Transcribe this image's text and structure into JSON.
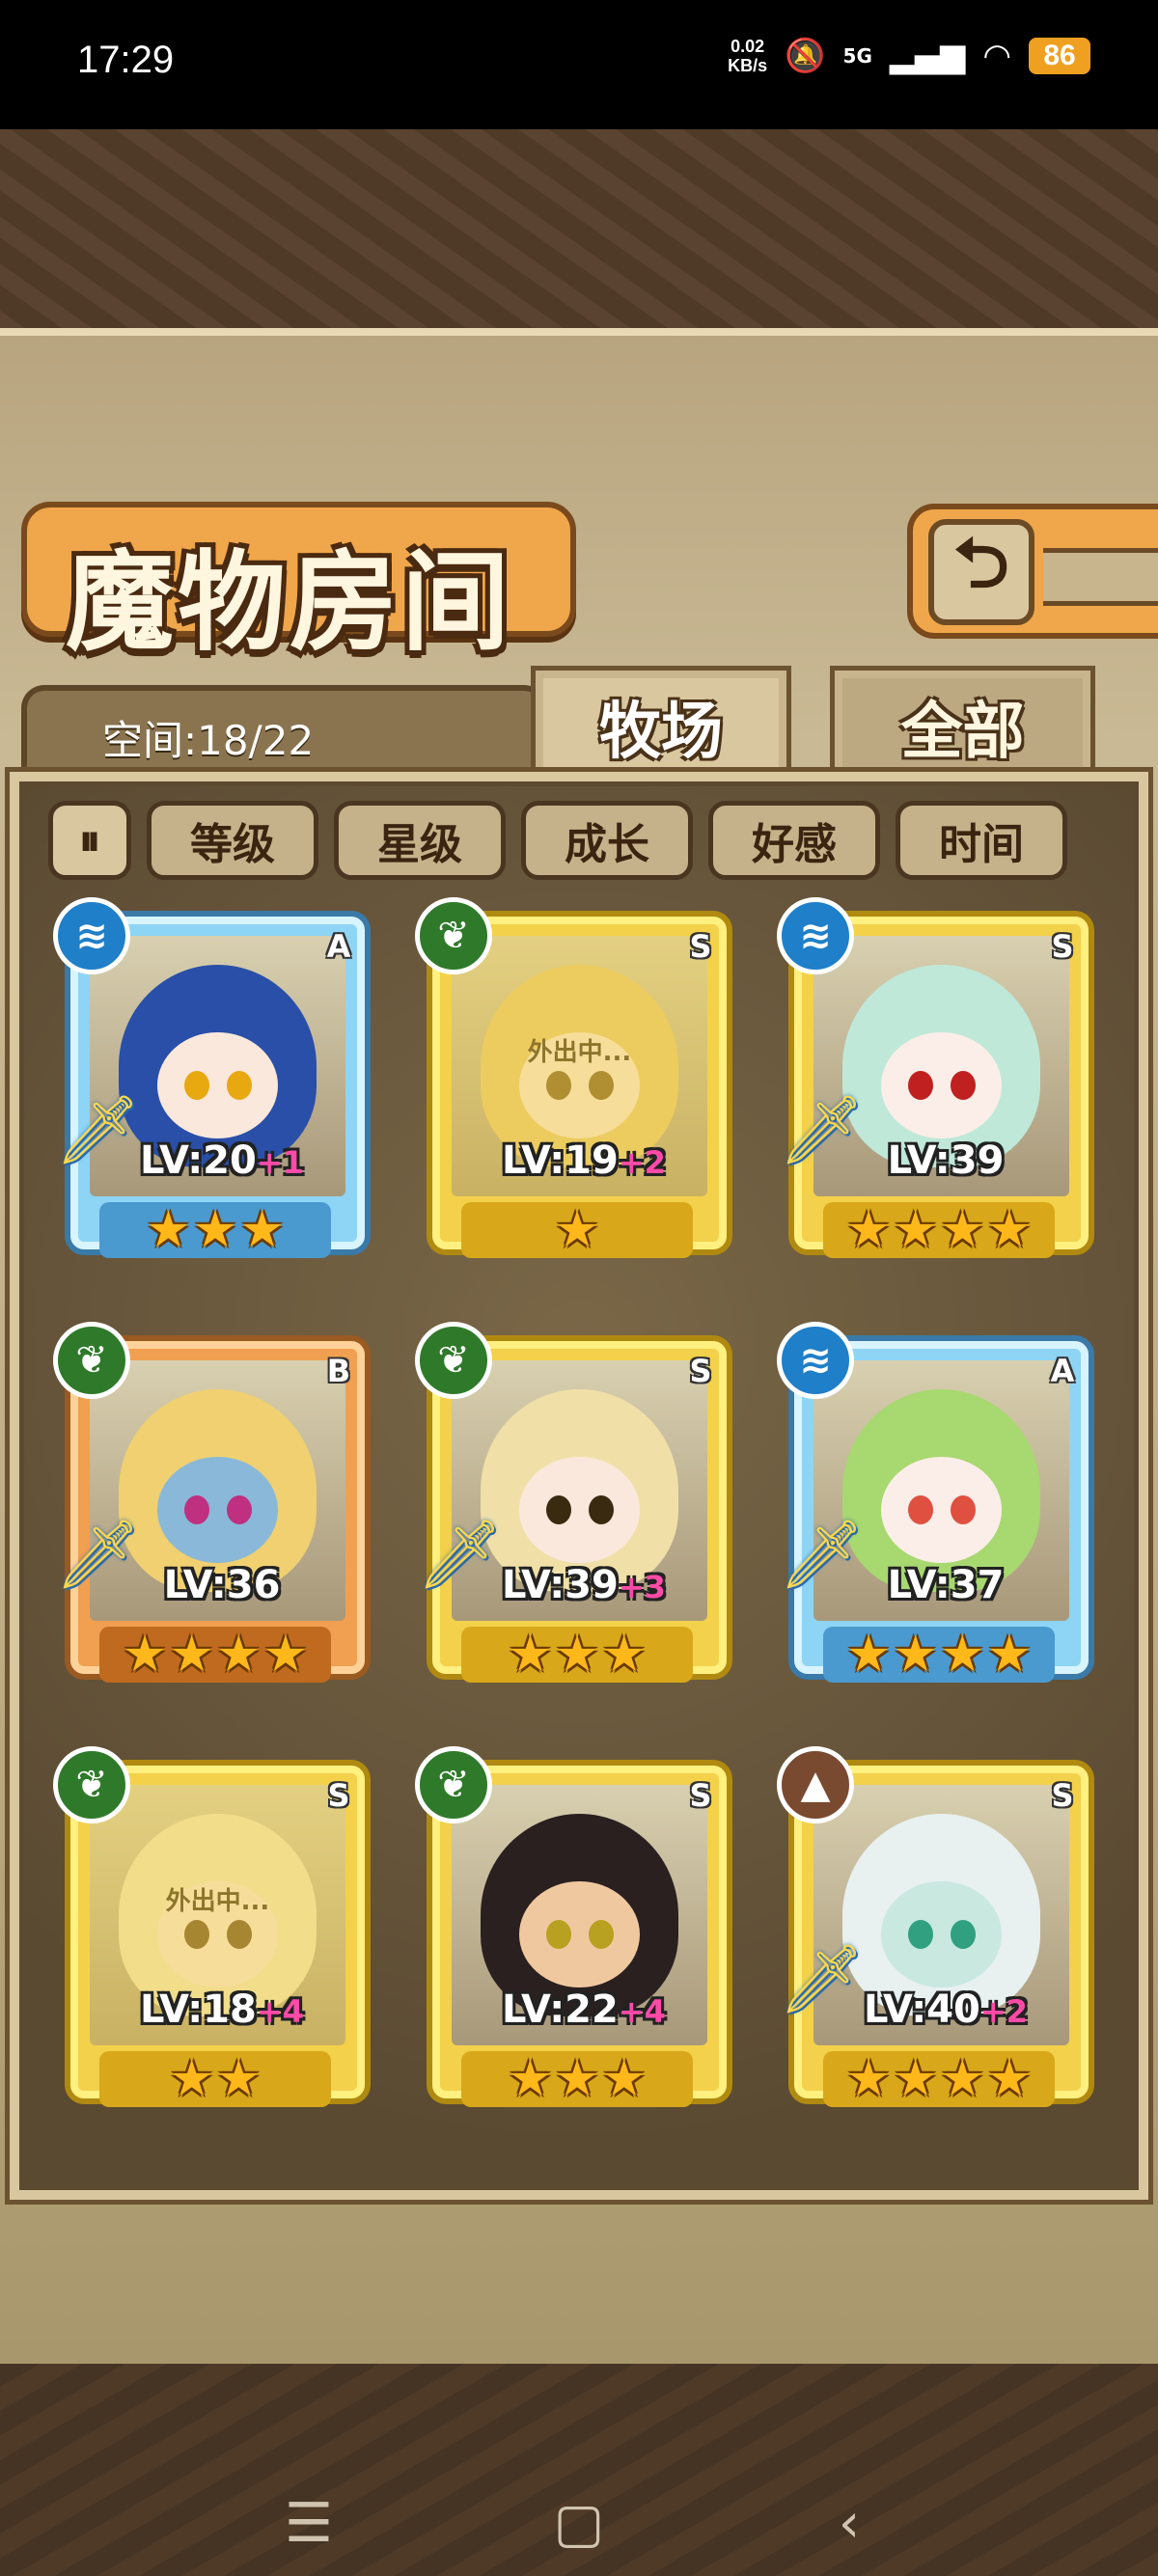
{
  "status_bar": {
    "time": "17:29",
    "net_speed_value": "0.02",
    "net_speed_unit": "KB/s",
    "network": "5G",
    "battery": "86"
  },
  "header": {
    "title": "魔物房间",
    "back_icon": "back-arrow-icon"
  },
  "space": {
    "label": "空间:18/22"
  },
  "tabs": [
    {
      "label": "牧场",
      "active": true
    },
    {
      "label": "全部",
      "active": false
    }
  ],
  "sort": {
    "toggle_icon": "sort-order-icon",
    "options": [
      "等级",
      "星级",
      "成长",
      "好感",
      "时间"
    ]
  },
  "monsters": [
    {
      "element": "water",
      "grade": "A",
      "level": "LV:20",
      "bonus": "+1",
      "stars": 3,
      "equipped": true,
      "status": ""
    },
    {
      "element": "grass",
      "grade": "S",
      "level": "LV:19",
      "bonus": "+2",
      "stars": 1,
      "equipped": false,
      "status": "外出中..."
    },
    {
      "element": "water",
      "grade": "S",
      "level": "LV:39",
      "bonus": "",
      "stars": 4,
      "equipped": true,
      "status": ""
    },
    {
      "element": "grass",
      "grade": "B",
      "level": "LV:36",
      "bonus": "",
      "stars": 4,
      "equipped": true,
      "status": ""
    },
    {
      "element": "grass",
      "grade": "S",
      "level": "LV:39",
      "bonus": "+3",
      "stars": 3,
      "equipped": true,
      "status": ""
    },
    {
      "element": "water",
      "grade": "A",
      "level": "LV:37",
      "bonus": "",
      "stars": 4,
      "equipped": true,
      "status": ""
    },
    {
      "element": "grass",
      "grade": "S",
      "level": "LV:18",
      "bonus": "+4",
      "stars": 2,
      "equipped": false,
      "status": "外出中..."
    },
    {
      "element": "grass",
      "grade": "S",
      "level": "LV:22",
      "bonus": "+4",
      "stars": 3,
      "equipped": false,
      "status": ""
    },
    {
      "element": "earth",
      "grade": "S",
      "level": "LV:40",
      "bonus": "+2",
      "stars": 4,
      "equipped": true,
      "status": ""
    }
  ],
  "colors": {
    "rarity_S": "#f3d14a",
    "rarity_A": "#8ed4f5",
    "rarity_B": "#f0a050",
    "level_bonus": "#ff4aa8"
  }
}
